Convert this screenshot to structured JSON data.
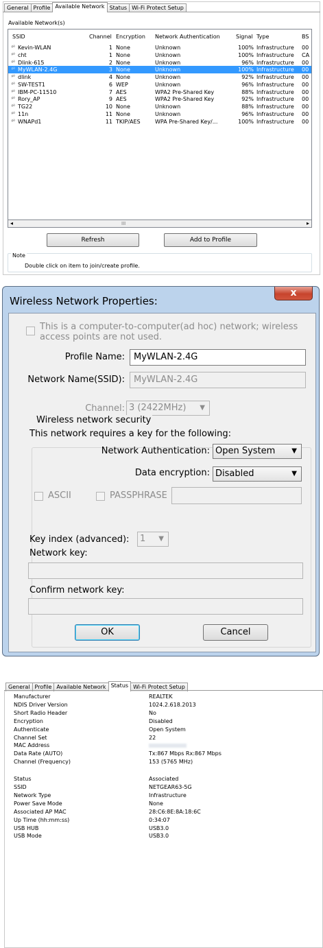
{
  "available_network": {
    "tabs": [
      {
        "label": "General",
        "active": false
      },
      {
        "label": "Profile",
        "active": false
      },
      {
        "label": "Available Network",
        "active": true
      },
      {
        "label": "Status",
        "active": false
      },
      {
        "label": "Wi-Fi Protect Setup",
        "active": false
      }
    ],
    "section_label": "Available Network(s)",
    "columns": [
      "SSID",
      "Channel",
      "Encryption",
      "Network Authentication",
      "Signal",
      "Type",
      "BS"
    ],
    "rows": [
      {
        "ssid": "Kevin-WLAN",
        "channel": "1",
        "encryption": "None",
        "auth": "Unknown",
        "signal": "100%",
        "type": "Infrastructure",
        "bssid": "00",
        "selected": false
      },
      {
        "ssid": "cht",
        "channel": "1",
        "encryption": "None",
        "auth": "Unknown",
        "signal": "100%",
        "type": "Infrastructure",
        "bssid": "CA",
        "selected": false
      },
      {
        "ssid": "Dlink-615",
        "channel": "2",
        "encryption": "None",
        "auth": "Unknown",
        "signal": "96%",
        "type": "Infrastructure",
        "bssid": "00",
        "selected": false
      },
      {
        "ssid": "MyWLAN-2.4G",
        "channel": "3",
        "encryption": "None",
        "auth": "Unknown",
        "signal": "100%",
        "type": "Infrastructure",
        "bssid": "00",
        "selected": true
      },
      {
        "ssid": "dlink",
        "channel": "4",
        "encryption": "None",
        "auth": "Unknown",
        "signal": "92%",
        "type": "Infrastructure",
        "bssid": "00",
        "selected": false
      },
      {
        "ssid": "SW-TEST1",
        "channel": "6",
        "encryption": "WEP",
        "auth": "Unknown",
        "signal": "96%",
        "type": "Infrastructure",
        "bssid": "00",
        "selected": false
      },
      {
        "ssid": "IBM-PC-11510",
        "channel": "7",
        "encryption": "AES",
        "auth": "WPA2 Pre-Shared Key",
        "signal": "88%",
        "type": "Infrastructure",
        "bssid": "00",
        "selected": false
      },
      {
        "ssid": "Rory_AP",
        "channel": "9",
        "encryption": "AES",
        "auth": "WPA2 Pre-Shared Key",
        "signal": "92%",
        "type": "Infrastructure",
        "bssid": "00",
        "selected": false
      },
      {
        "ssid": "TG22",
        "channel": "10",
        "encryption": "None",
        "auth": "Unknown",
        "signal": "88%",
        "type": "Infrastructure",
        "bssid": "00",
        "selected": false
      },
      {
        "ssid": "11n",
        "channel": "11",
        "encryption": "None",
        "auth": "Unknown",
        "signal": "96%",
        "type": "Infrastructure",
        "bssid": "00",
        "selected": false
      },
      {
        "ssid": "WNAPd1",
        "channel": "11",
        "encryption": "TKIP/AES",
        "auth": "WPA Pre-Shared Key/...",
        "signal": "100%",
        "type": "Infrastructure",
        "bssid": "00",
        "selected": false
      }
    ],
    "refresh_label": "Refresh",
    "add_to_profile_label": "Add to Profile",
    "note_title": "Note",
    "note_text": "Double click on item to join/create profile."
  },
  "wireless_props": {
    "title": "Wireless Network Properties:",
    "close_glyph": "x",
    "adhoc_line1": "This is a computer-to-computer(ad hoc) network; wireless",
    "adhoc_line2": "access points are not used.",
    "profile_name_label": "Profile Name:",
    "profile_name_value": "MyWLAN-2.4G",
    "ssid_label": "Network Name(SSID):",
    "ssid_value": "MyWLAN-2.4G",
    "channel_label": "Channel:",
    "channel_value": "3  (2422MHz)",
    "security_group_label": "Wireless network security",
    "requires_key_text": "This network requires a key for the following:",
    "auth_label": "Network Authentication:",
    "auth_value": "Open System",
    "encryption_label": "Data encryption:",
    "encryption_value": "Disabled",
    "ascii_label": "ASCII",
    "passphrase_label": "PASSPHRASE",
    "key_index_label": "Key index (advanced):",
    "key_index_value": "1",
    "network_key_label": "Network key:",
    "confirm_key_label": "Confirm network key:",
    "ok_label": "OK",
    "cancel_label": "Cancel"
  },
  "status_panel": {
    "tabs": [
      {
        "label": "General",
        "active": false
      },
      {
        "label": "Profile",
        "active": false
      },
      {
        "label": "Available Network",
        "active": false
      },
      {
        "label": "Status",
        "active": true
      },
      {
        "label": "Wi-Fi Protect Setup",
        "active": false
      }
    ],
    "rows": [
      {
        "label": "Manufacturer",
        "value": "REALTEK"
      },
      {
        "label": "NDIS Driver Version",
        "value": "1024.2.618.2013"
      },
      {
        "label": "Short Radio Header",
        "value": "No"
      },
      {
        "label": "Encryption",
        "value": "Disabled"
      },
      {
        "label": "Authenticate",
        "value": "Open System"
      },
      {
        "label": "Channel Set",
        "value": "22"
      },
      {
        "label": "MAC Address",
        "value": ""
      },
      {
        "label": "Data Rate (AUTO)",
        "value": "Tx:867 Mbps Rx:867 Mbps"
      },
      {
        "label": "Channel (Frequency)",
        "value": "153 (5765 MHz)"
      },
      {
        "label": "Status",
        "value": "Associated"
      },
      {
        "label": "SSID",
        "value": "NETGEAR63-5G"
      },
      {
        "label": "Network Type",
        "value": "Infrastructure"
      },
      {
        "label": "Power Save Mode",
        "value": "None"
      },
      {
        "label": "Associated AP MAC",
        "value": "28:C6:8E:8A:18:6C"
      },
      {
        "label": "Up Time (hh:mm:ss)",
        "value": "0:34:07"
      },
      {
        "label": "USB HUB",
        "value": "USB3.0"
      },
      {
        "label": "USB Mode",
        "value": "USB3.0"
      }
    ]
  }
}
